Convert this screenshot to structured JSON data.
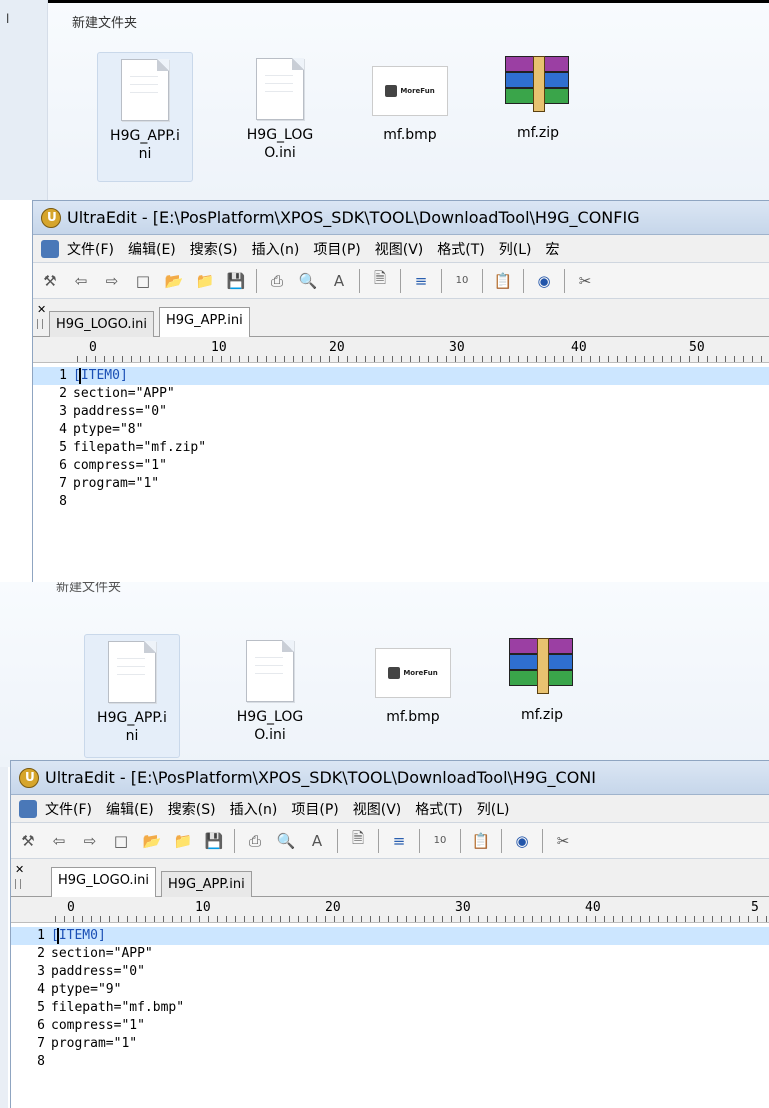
{
  "panels": [
    {
      "explorer": {
        "left_title": "l",
        "title": "新建文件夹",
        "files": [
          {
            "name": "H9G_APP.i\nni",
            "type": "ini",
            "selected": true
          },
          {
            "name": "H9G_LOG\nO.ini",
            "type": "ini",
            "selected": false
          },
          {
            "name": "mf.bmp",
            "type": "bmp",
            "selected": false,
            "brand": "MoreFun"
          },
          {
            "name": "mf.zip",
            "type": "zip",
            "selected": false
          }
        ]
      },
      "editor": {
        "title": "UltraEdit - [E:\\PosPlatform\\XPOS_SDK\\TOOL\\DownloadTool\\H9G_CONFIG",
        "menu": [
          "文件(F)",
          "编辑(E)",
          "搜索(S)",
          "插入(n)",
          "项目(P)",
          "视图(V)",
          "格式(T)",
          "列(L)",
          "宏"
        ],
        "tabs": [
          {
            "label": "H9G_LOGO.ini",
            "active": false
          },
          {
            "label": "H9G_APP.ini",
            "active": true
          }
        ],
        "ruler": [
          "0",
          "10",
          "20",
          "30",
          "40",
          "50"
        ],
        "lines": [
          {
            "n": "1",
            "text": "[ITEM0]"
          },
          {
            "n": "2",
            "text": "section=\"APP\""
          },
          {
            "n": "3",
            "text": "paddress=\"0\""
          },
          {
            "n": "4",
            "text": "ptype=\"8\""
          },
          {
            "n": "5",
            "text": "filepath=\"mf.zip\""
          },
          {
            "n": "6",
            "text": "compress=\"1\""
          },
          {
            "n": "7",
            "text": "program=\"1\""
          },
          {
            "n": "8",
            "text": ""
          }
        ]
      }
    },
    {
      "explorer": {
        "left_title": "",
        "title": "新建文件夹",
        "files": [
          {
            "name": "H9G_APP.i\nni",
            "type": "ini",
            "selected": true
          },
          {
            "name": "H9G_LOG\nO.ini",
            "type": "ini",
            "selected": false
          },
          {
            "name": "mf.bmp",
            "type": "bmp",
            "selected": false,
            "brand": "MoreFun"
          },
          {
            "name": "mf.zip",
            "type": "zip",
            "selected": false
          }
        ]
      },
      "editor": {
        "title": "UltraEdit - [E:\\PosPlatform\\XPOS_SDK\\TOOL\\DownloadTool\\H9G_CONI",
        "menu": [
          "文件(F)",
          "编辑(E)",
          "搜索(S)",
          "插入(n)",
          "项目(P)",
          "视图(V)",
          "格式(T)",
          "列(L)"
        ],
        "tabs": [
          {
            "label": "H9G_LOGO.ini",
            "active": true
          },
          {
            "label": "H9G_APP.ini",
            "active": false
          }
        ],
        "ruler": [
          "0",
          "10",
          "20",
          "30",
          "40",
          "5"
        ],
        "lines": [
          {
            "n": "1",
            "text": "[ITEM0]"
          },
          {
            "n": "2",
            "text": "section=\"APP\""
          },
          {
            "n": "3",
            "text": "paddress=\"0\""
          },
          {
            "n": "4",
            "text": "ptype=\"9\""
          },
          {
            "n": "5",
            "text": "filepath=\"mf.bmp\""
          },
          {
            "n": "6",
            "text": "compress=\"1\""
          },
          {
            "n": "7",
            "text": "program=\"1\""
          },
          {
            "n": "8",
            "text": ""
          }
        ]
      }
    }
  ],
  "colors": {
    "highlight_line": "#cce6ff",
    "keyword": "#1a4fb5",
    "title_bar": "#c6d6ea"
  }
}
